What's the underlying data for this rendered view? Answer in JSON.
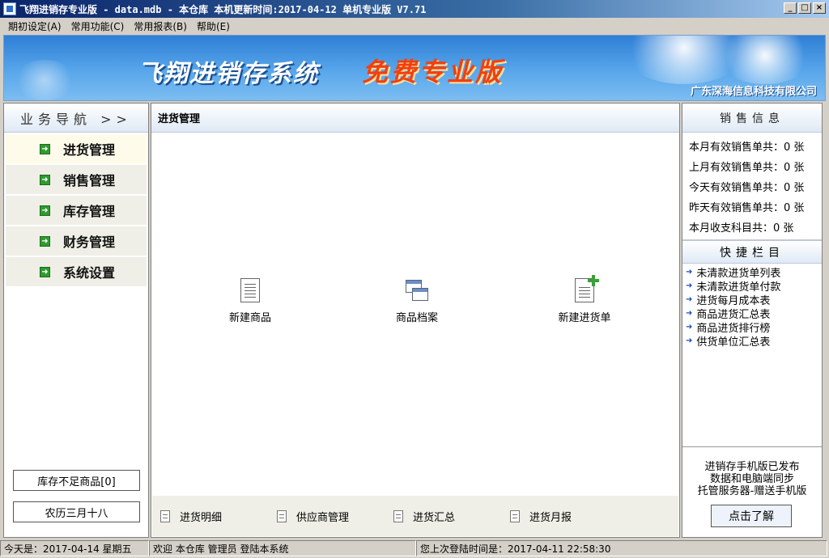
{
  "window": {
    "title": "飞翔进销存专业版 - data.mdb - 本仓库  本机更新时间:2017-04-12 单机专业版 V7.71",
    "min": "_",
    "max": "□",
    "close": "×"
  },
  "menu": [
    {
      "label": "期初设定(A)"
    },
    {
      "label": "常用功能(C)"
    },
    {
      "label": "常用报表(B)"
    },
    {
      "label": "帮助(E)"
    }
  ],
  "banner": {
    "title": "飞翔进销存系统",
    "subtitle": "免费专业版",
    "company": "广东深海信息科技有限公司"
  },
  "nav": {
    "header": "业务导航 >>",
    "items": [
      {
        "label": "进货管理"
      },
      {
        "label": "销售管理"
      },
      {
        "label": "库存管理"
      },
      {
        "label": "财务管理"
      },
      {
        "label": "系统设置"
      }
    ],
    "stock_button": "库存不足商品[0]",
    "lunar_button": "农历三月十八"
  },
  "main": {
    "header": "进货管理",
    "icons": [
      {
        "label": "新建商品",
        "icon": "document-icon"
      },
      {
        "label": "商品档案",
        "icon": "windows-icon"
      },
      {
        "label": "新建进货单",
        "icon": "new-document-icon"
      }
    ],
    "bottom_items": [
      {
        "label": "进货明细"
      },
      {
        "label": "供应商管理"
      },
      {
        "label": "进货汇总"
      },
      {
        "label": "进货月报"
      }
    ]
  },
  "sales": {
    "header": "销售信息",
    "stats": [
      {
        "text": "本月有效销售单共：0 张"
      },
      {
        "text": "上月有效销售单共：0 张"
      },
      {
        "text": "今天有效销售单共：0 张"
      },
      {
        "text": "昨天有效销售单共：0 张"
      },
      {
        "text": "本月收支科目共：0 张"
      }
    ]
  },
  "quick": {
    "header": "快捷栏目",
    "arrow": "➜",
    "items": [
      {
        "label": "未清款进货单列表"
      },
      {
        "label": "未清款进货单付款"
      },
      {
        "label": "进货每月成本表"
      },
      {
        "label": "商品进货汇总表"
      },
      {
        "label": "商品进货排行榜"
      },
      {
        "label": "供货单位汇总表"
      }
    ]
  },
  "promo": {
    "line1": "进销存手机版已发布",
    "line2": "数据和电脑端同步",
    "line3": "托管服务器-赠送手机版",
    "button": "点击了解"
  },
  "status": {
    "today": "今天是：2017-04-14  星期五",
    "welcome": "欢迎 本仓库 管理员  登陆本系统",
    "last_login": "您上次登陆时间是：2017-04-11 22:58:30"
  },
  "colors": {
    "banner": "#3a8ee0",
    "subtitle": "#f04010",
    "nav_arrow": "#2f9a2f"
  }
}
